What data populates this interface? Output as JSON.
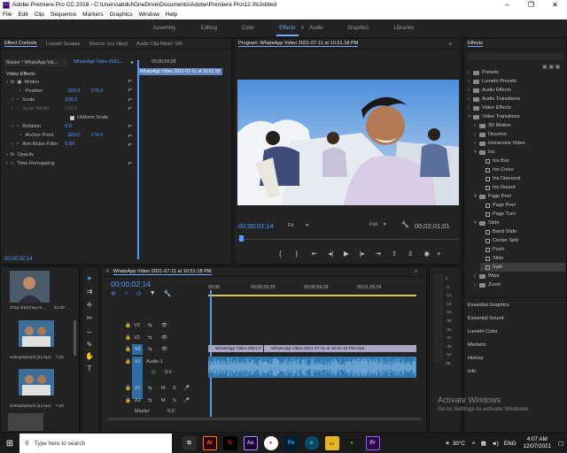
{
  "window": {
    "title": "Adobe Premiere Pro CC 2018 - C:\\Users\\abdul\\OneDrive\\Documents\\Adobe\\Premiere Pro\\12.0\\Untitled"
  },
  "menu": [
    "File",
    "Edit",
    "Clip",
    "Sequence",
    "Markers",
    "Graphics",
    "Window",
    "Help"
  ],
  "workspaces": [
    "Assembly",
    "Editing",
    "Color",
    "Effects",
    "Audio",
    "Graphics",
    "Libraries"
  ],
  "effect_controls": {
    "tabs": [
      "Effect Controls",
      "Lumetri Scopes",
      "Source: (no clips)",
      "Audio Clip Mixer: Wh"
    ],
    "master": "Master * WhatsApp Vid...",
    "sequence_sel": "WhatsApp Video 2021...",
    "ruler_time": "00;00;59;28",
    "clip_label": "WhatsApp Video 2021-07-11 at 10:51:18",
    "section": "Video Effects",
    "motion": "Motion",
    "position_label": "Position",
    "position_x": "320.0",
    "position_y": "176.0",
    "scale_label": "Scale",
    "scale": "100.0",
    "scale_width_label": "Scale Width",
    "scale_width": "100.0",
    "uniform_scale": "Uniform Scale",
    "rotation_label": "Rotation",
    "rotation": "0.0",
    "anchor_label": "Anchor Point",
    "anchor_x": "320.0",
    "anchor_y": "176.0",
    "antiflicker_label": "Anti-flicker Filter",
    "antiflicker": "0.00",
    "opacity": "Opacity",
    "time_remap": "Time Remapping",
    "timecode": "00;00;02;14"
  },
  "program": {
    "title": "Program: WhatsApp Video 2021-07-11 at 10.51.18 PM",
    "timecode": "00;00;02;14",
    "fit": "Fit",
    "quality": "Full",
    "duration": "00;02;01;01"
  },
  "effects_panel": {
    "title": "Effects",
    "items": [
      {
        "label": "Presets",
        "type": "folder",
        "indent": 0
      },
      {
        "label": "Lumetri Presets",
        "type": "folder",
        "indent": 0
      },
      {
        "label": "Audio Effects",
        "type": "folder",
        "indent": 0
      },
      {
        "label": "Audio Transitions",
        "type": "folder",
        "indent": 0
      },
      {
        "label": "Video Effects",
        "type": "folder",
        "indent": 0
      },
      {
        "label": "Video Transitions",
        "type": "folder-open",
        "indent": 0
      },
      {
        "label": "3D Motion",
        "type": "folder",
        "indent": 1
      },
      {
        "label": "Dissolve",
        "type": "folder",
        "indent": 1
      },
      {
        "label": "Immersive Video",
        "type": "folder",
        "indent": 1
      },
      {
        "label": "Iris",
        "type": "folder-open",
        "indent": 1
      },
      {
        "label": "Iris Box",
        "type": "fx",
        "indent": 2
      },
      {
        "label": "Iris Cross",
        "type": "fx",
        "indent": 2
      },
      {
        "label": "Iris Diamond",
        "type": "fx",
        "indent": 2
      },
      {
        "label": "Iris Round",
        "type": "fx",
        "indent": 2
      },
      {
        "label": "Page Peel",
        "type": "folder-open",
        "indent": 1
      },
      {
        "label": "Page Peel",
        "type": "fx",
        "indent": 2
      },
      {
        "label": "Page Turn",
        "type": "fx",
        "indent": 2
      },
      {
        "label": "Slide",
        "type": "folder-open",
        "indent": 1
      },
      {
        "label": "Band Slide",
        "type": "fx",
        "indent": 2
      },
      {
        "label": "Center Split",
        "type": "fx",
        "indent": 2
      },
      {
        "label": "Push",
        "type": "fx",
        "indent": 2
      },
      {
        "label": "Slide",
        "type": "fx",
        "indent": 2
      },
      {
        "label": "Split",
        "type": "fx",
        "indent": 2,
        "selected": true
      },
      {
        "label": "Wipe",
        "type": "folder",
        "indent": 1
      },
      {
        "label": "Zoom",
        "type": "folder",
        "indent": 1
      }
    ],
    "sections": [
      "Essential Graphics",
      "Essential Sound",
      "Lumetri Color",
      "Markers",
      "History",
      "Info"
    ]
  },
  "project": {
    "items": [
      {
        "name": "Chup Iklo(chup-m...",
        "dur": "52:20"
      },
      {
        "name": "videoplayback (2).mp4",
        "dur": "7:20"
      },
      {
        "name": "videoplayback (2).mp4",
        "dur": "7:20"
      }
    ]
  },
  "timeline": {
    "tab": "WhatsApp Video 2021-07-11 at 10:51:18 PM",
    "timecode": "00;00;02;14",
    "ruler": [
      "00;00",
      "00;00;29;29",
      "00;00;59;28",
      "00;01;29;29"
    ],
    "tracks_video": [
      "V3",
      "V2",
      "V1"
    ],
    "tracks_audio": [
      "A1",
      "A2",
      "A3"
    ],
    "audio1_name": "Audio 1",
    "audio1_value": "0.0",
    "master_label": "Master",
    "master_value": "0.0",
    "clip1": "WhatsApp Video 2021-0",
    "clip2": "WhatsApp Video 2021-07-11 at 10:51:18 PM.mp4"
  },
  "watermark": {
    "line1": "Activate Windows",
    "line2": "Go to Settings to activate Windows."
  },
  "taskbar": {
    "search_placeholder": "Type here to search",
    "temp": "30°C",
    "lang": "ENG",
    "time": "4:07 AM",
    "date": "12/07/2021"
  }
}
